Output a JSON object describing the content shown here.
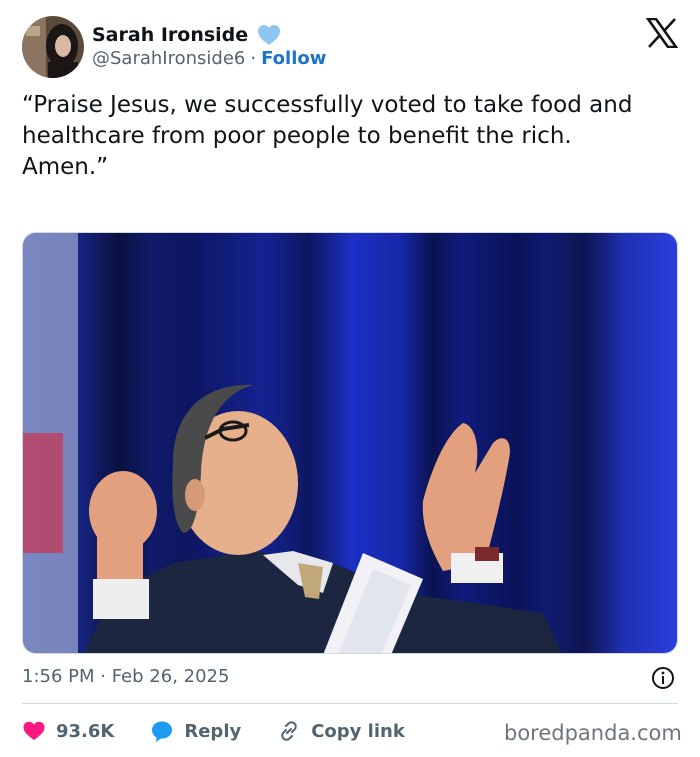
{
  "author": {
    "display_name": "Sarah Ironside",
    "handle": "@SarahIronside6",
    "separator": "·",
    "follow_label": "Follow",
    "verified_color": "#8ec6ef"
  },
  "tweet": {
    "text": "“Praise Jesus, we successfully voted to take food and healthcare from poor people to benefit the rich.\nAmen.”",
    "timestamp": "1:56 PM · Feb 26, 2025"
  },
  "media": {
    "icon": "photo"
  },
  "actions": {
    "like_count": "93.6K",
    "reply_label": "Reply",
    "copy_link_label": "Copy link",
    "like_color": "#f91880",
    "reply_color": "#1d9bf0"
  },
  "watermark": "boredpanda.com",
  "icons": [
    "verified-badge-icon",
    "x-logo-icon",
    "info-icon",
    "heart-icon",
    "reply-bubble-icon",
    "link-icon"
  ]
}
